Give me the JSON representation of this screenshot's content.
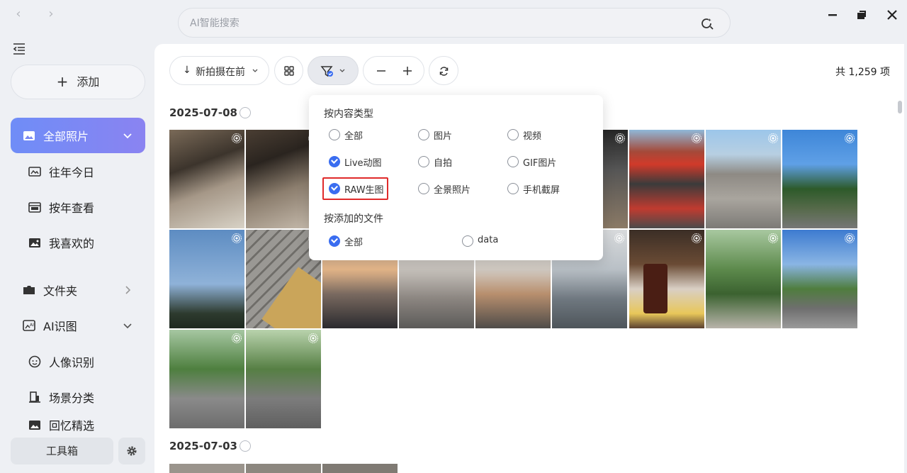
{
  "search": {
    "placeholder": "AI智能搜索"
  },
  "sidebar": {
    "add_label": "添加",
    "active": {
      "label": "全部照片"
    },
    "items": [
      {
        "label": "往年今日",
        "icon": "image-frame-icon"
      },
      {
        "label": "按年查看",
        "icon": "calendar-icon"
      },
      {
        "label": "我喜欢的",
        "icon": "favorite-image-icon"
      },
      {
        "label": "文件夹",
        "icon": "folder-icon"
      },
      {
        "label": "AI识图",
        "icon": "ai-image-icon"
      },
      {
        "label": "人像识别",
        "icon": "face-icon"
      },
      {
        "label": "场景分类",
        "icon": "scene-icon"
      },
      {
        "label": "回忆精选",
        "icon": "memories-icon"
      }
    ],
    "toolbox_label": "工具箱"
  },
  "toolbar": {
    "sort_label": "新拍摄在前",
    "count_label": "共 1,259 项"
  },
  "groups": [
    {
      "date": "2025-07-08"
    },
    {
      "date": "2025-07-03"
    }
  ],
  "filter": {
    "section_content_type": "按内容类型",
    "content_options": [
      {
        "label": "全部",
        "checked": false
      },
      {
        "label": "图片",
        "checked": false
      },
      {
        "label": "视频",
        "checked": false
      },
      {
        "label": "Live动图",
        "checked": true
      },
      {
        "label": "自拍",
        "checked": false
      },
      {
        "label": "GIF图片",
        "checked": false
      },
      {
        "label": "RAW生图",
        "checked": true
      },
      {
        "label": "全景照片",
        "checked": false
      },
      {
        "label": "手机截屏",
        "checked": false
      }
    ],
    "section_added_files": "按添加的文件",
    "file_options": [
      {
        "label": "全部",
        "checked": true
      },
      {
        "label": "data",
        "checked": false
      }
    ]
  },
  "colors": {
    "accent": "#3a6df0",
    "nav_gradient_start": "#6f8df7",
    "nav_gradient_end": "#8a83f1",
    "highlight": "#e02a2a"
  }
}
